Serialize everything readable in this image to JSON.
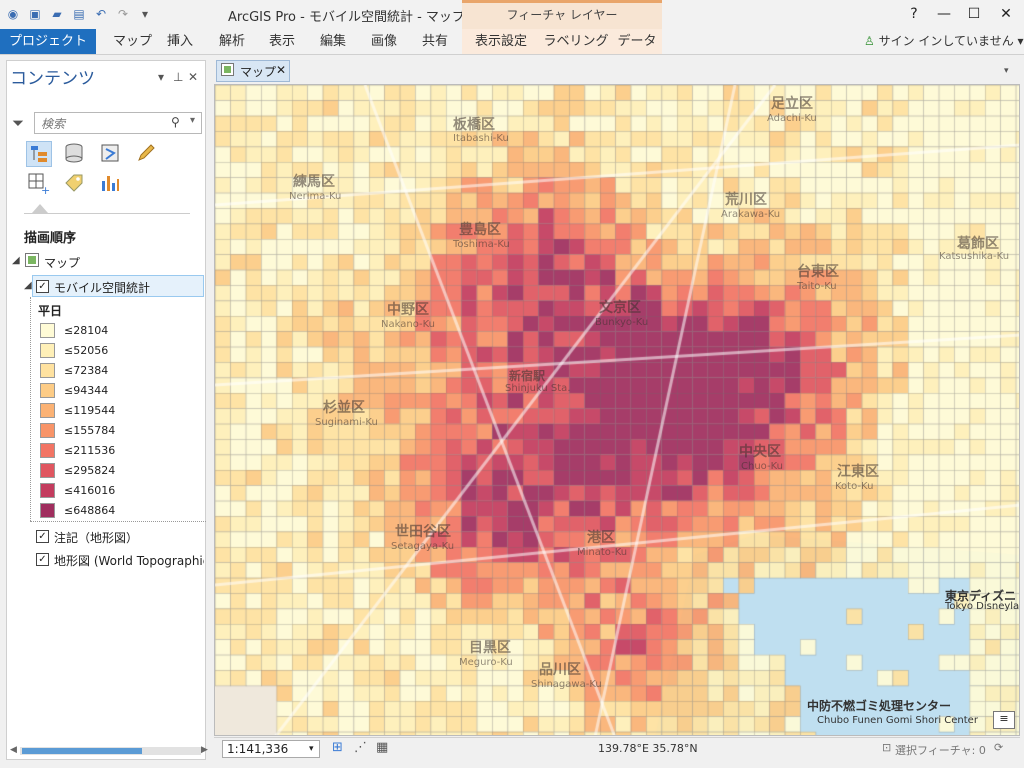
{
  "app": {
    "title": "ArcGIS Pro - モバイル空間統計 - マップ",
    "context_tab": "フィーチャ レイヤー",
    "window_buttons": [
      "?",
      "—",
      "☐",
      "✕"
    ]
  },
  "ribbon": {
    "project": "プロジェクト",
    "tabs": [
      "マップ",
      "挿入",
      "解析",
      "表示",
      "編集",
      "画像",
      "共有",
      "表示設定",
      "ラベリング",
      "データ"
    ],
    "signin": "サイン インしていません"
  },
  "contents": {
    "title": "コンテンツ",
    "search_placeholder": "検索",
    "draw_order": "描画順序",
    "map_item": "マップ",
    "layer": "モバイル空間統計",
    "legend_field": "平日",
    "legend": [
      {
        "label": "≤28104",
        "color": "#fffbd6"
      },
      {
        "label": "≤52056",
        "color": "#fff0b8"
      },
      {
        "label": "≤72384",
        "color": "#ffe2a0"
      },
      {
        "label": "≤94344",
        "color": "#fdcc86"
      },
      {
        "label": "≤119544",
        "color": "#fbb274"
      },
      {
        "label": "≤155784",
        "color": "#f89468"
      },
      {
        "label": "≤211536",
        "color": "#f27464"
      },
      {
        "label": "≤295824",
        "color": "#e05660"
      },
      {
        "label": "≤416016",
        "color": "#c33c5e"
      },
      {
        "label": "≤648864",
        "color": "#a02e5e"
      }
    ],
    "other_layers": [
      "注記（地形図）",
      "地形図 (World Topographic M"
    ]
  },
  "map": {
    "tab": "マップ",
    "labels": [
      {
        "t": "板橋区",
        "s": "Itabashi-Ku"
      },
      {
        "t": "足立区",
        "s": "Adachi-Ku"
      },
      {
        "t": "練馬区",
        "s": "Nerima-Ku"
      },
      {
        "t": "荒川区",
        "s": "Arakawa-Ku"
      },
      {
        "t": "豊島区",
        "s": "Toshima-Ku"
      },
      {
        "t": "葛飾区",
        "s": "Katsushika-Ku"
      },
      {
        "t": "中野区",
        "s": "Nakano-Ku"
      },
      {
        "t": "文京区",
        "s": "Bunkyo-Ku"
      },
      {
        "t": "台東区",
        "s": "Taito-Ku"
      },
      {
        "t": "杉並区",
        "s": "Suginami-Ku"
      },
      {
        "t": "新宿駅",
        "s": "Shinjuku Sta."
      },
      {
        "t": "中央区",
        "s": "Chuo-Ku"
      },
      {
        "t": "江東区",
        "s": "Koto-Ku"
      },
      {
        "t": "世田谷区",
        "s": "Setagaya-Ku"
      },
      {
        "t": "港区",
        "s": "Minato-Ku"
      },
      {
        "t": "目黒区",
        "s": "Meguro-Ku"
      },
      {
        "t": "品川区",
        "s": "Shinagawa-Ku"
      },
      {
        "t": "東京ディズニ",
        "s": "Tokyo Disneyland"
      },
      {
        "t": "中防不燃ゴミ処理センター",
        "s": "Chubo Funen Gomi Shori Center"
      }
    ]
  },
  "status": {
    "scale": "1:141,336",
    "coords": "139.78°E 35.78°N",
    "selected": "選択フィーチャ: 0"
  }
}
